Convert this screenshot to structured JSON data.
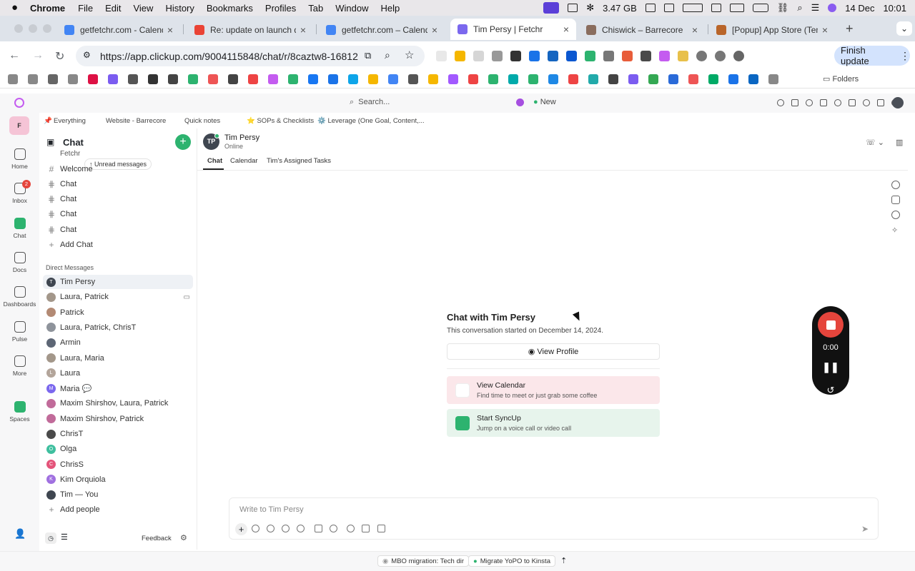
{
  "menubar": {
    "app": "Chrome",
    "items": [
      "File",
      "Edit",
      "View",
      "History",
      "Bookmarks",
      "Profiles",
      "Tab",
      "Window",
      "Help"
    ],
    "memory": "3.47 GB",
    "date": "14 Dec",
    "time": "10:01"
  },
  "tabs": [
    {
      "title": "getfetchr.com - Calend",
      "fav_color": "#4285f4"
    },
    {
      "title": "Re: update on launch de",
      "fav_color": "#ea4335"
    },
    {
      "title": "getfetchr.com – Calend",
      "fav_color": "#4285f4"
    },
    {
      "title": "Tim Persy | Fetchr",
      "fav_color": "#7b68ee",
      "active": true
    },
    {
      "title": "Chiswick – Barrecore",
      "fav_color": "#8a6d5e"
    },
    {
      "title": "[Popup] App Store (Tem",
      "fav_color": "#b9652a"
    }
  ],
  "url": "https://app.clickup.com/9004115848/chat/r/8caztw8-16812",
  "finish_update": "Finish update",
  "bookmarks_folder": "Folders",
  "topbar": {
    "search_placeholder": "Search...",
    "new_label": "New"
  },
  "favorites": [
    "Everything",
    "Website - Barrecore",
    "Quick notes",
    "⭐ SOPs & Checklists",
    "⚙️ Leverage (One Goal, Content,..."
  ],
  "rail": [
    {
      "label": "Home"
    },
    {
      "label": "Inbox",
      "badge": "2"
    },
    {
      "label": "Chat"
    },
    {
      "label": "Docs"
    },
    {
      "label": "Dashboards"
    },
    {
      "label": "Pulse"
    },
    {
      "label": "More"
    },
    {
      "label": "Spaces"
    }
  ],
  "workspace_initial": "F",
  "sidebar": {
    "title": "Chat",
    "partial_item": "Fetchr",
    "unread_pill": "Unread messages",
    "channels": [
      "Welcome",
      "Chat",
      "Chat",
      "Chat",
      "Chat"
    ],
    "add_chat": "Add Chat",
    "dm_header": "Direct Messages",
    "dms": [
      {
        "name": "Tim Persy",
        "initial": "T",
        "color": "#3f4650"
      },
      {
        "name": "Laura, Patrick",
        "initial": "",
        "color": "#a3978a"
      },
      {
        "name": "Patrick",
        "initial": "",
        "color": "#b38a74"
      },
      {
        "name": "Laura, Patrick, ChrisT",
        "initial": "",
        "color": "#8e939b"
      },
      {
        "name": "Armin",
        "initial": "",
        "color": "#5d6675"
      },
      {
        "name": "Laura, Maria",
        "initial": "",
        "color": "#a3978a"
      },
      {
        "name": "Laura",
        "initial": "L",
        "color": "#b3a59a"
      },
      {
        "name": "Maria 💬",
        "initial": "M",
        "color": "#7b68ee"
      },
      {
        "name": "Maxim Shirshov, Laura, Patrick",
        "initial": "",
        "color": "#c16b9a"
      },
      {
        "name": "Maxim Shirshov, Patrick",
        "initial": "",
        "color": "#c16b9a"
      },
      {
        "name": "ChrisT",
        "initial": "",
        "color": "#4a4a4a"
      },
      {
        "name": "Olga",
        "initial": "O",
        "color": "#3fbf9f"
      },
      {
        "name": "ChrisS",
        "initial": "C",
        "color": "#e4547a"
      },
      {
        "name": "Kim Orquiola",
        "initial": "K",
        "color": "#a070e0"
      },
      {
        "name": "Tim — You",
        "initial": "",
        "color": "#3f4650"
      }
    ],
    "add_people": "Add people",
    "feedback": "Feedback"
  },
  "chat_header": {
    "initials": "TP",
    "name": "Tim Persy",
    "status": "Online"
  },
  "chat_tabs": [
    "Chat",
    "Calendar",
    "Tim's Assigned Tasks"
  ],
  "intro": {
    "title": "Chat with Tim Persy",
    "subtitle": "This conversation started on December 14, 2024.",
    "view_profile": "View Profile",
    "options": [
      {
        "title": "View Calendar",
        "desc": "Find time to meet or just grab some coffee",
        "bg": "#fbe7ea"
      },
      {
        "title": "Start SyncUp",
        "desc": "Jump on a voice call or video call",
        "bg": "#e7f4ec"
      }
    ]
  },
  "recorder": {
    "time": "0:00"
  },
  "composer": {
    "placeholder": "Write to Tim Persy"
  },
  "status_tasks": [
    "MBO migration: Tech dir",
    "Migrate YoPO to Kinsta"
  ]
}
